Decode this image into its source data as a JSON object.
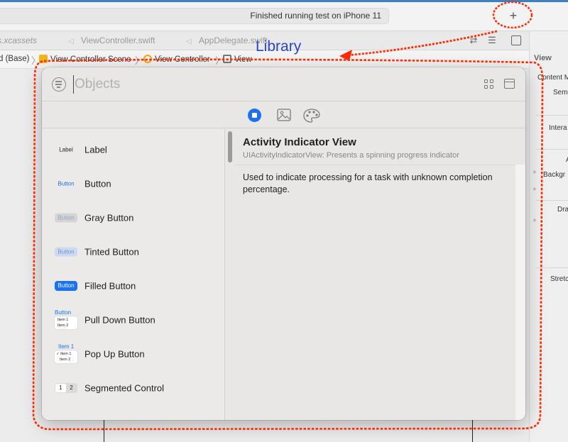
{
  "toolbar": {
    "status": "Finished running test on iPhone 11",
    "add_label": "+"
  },
  "editor_tabs": [
    {
      "label": "s.xcassets"
    },
    {
      "label": "ViewController.swift"
    },
    {
      "label": "AppDelegate.swift"
    }
  ],
  "jump_bar": {
    "crumb_1": "d (Base)",
    "crumb_2": "View Controller Scene",
    "crumb_3": "View Controller",
    "crumb_4": "View"
  },
  "inspector": {
    "heading": "View",
    "rows": [
      "Content M",
      "Sem",
      "Intera",
      "A",
      "Backgr",
      "Dra",
      "Stretc"
    ]
  },
  "annotation": {
    "label": "Library",
    "color": "#ff2a00"
  },
  "library": {
    "search_placeholder": "Objects",
    "items": [
      {
        "name": "Label",
        "thumb": "Label"
      },
      {
        "name": "Button",
        "thumb": "Button"
      },
      {
        "name": "Gray Button",
        "thumb": "Button"
      },
      {
        "name": "Tinted Button",
        "thumb": "Button"
      },
      {
        "name": "Filled Button",
        "thumb": "Button"
      },
      {
        "name": "Pull Down Button",
        "thumb": "Button",
        "thumb_items": [
          "Item 1",
          "Item 2"
        ]
      },
      {
        "name": "Pop Up Button",
        "thumb": "Item 1",
        "thumb_items": [
          "Item 1",
          "Item 2"
        ]
      },
      {
        "name": "Segmented Control",
        "thumb_segments": [
          "1",
          "2"
        ]
      }
    ],
    "detail": {
      "title": "Activity Indicator View",
      "class_line": "UIActivityIndicatorView: Presents a spinning progress indicator",
      "description": "Used to indicate processing for a task with unknown completion percentage."
    },
    "accent_color": "#1a72f0"
  }
}
